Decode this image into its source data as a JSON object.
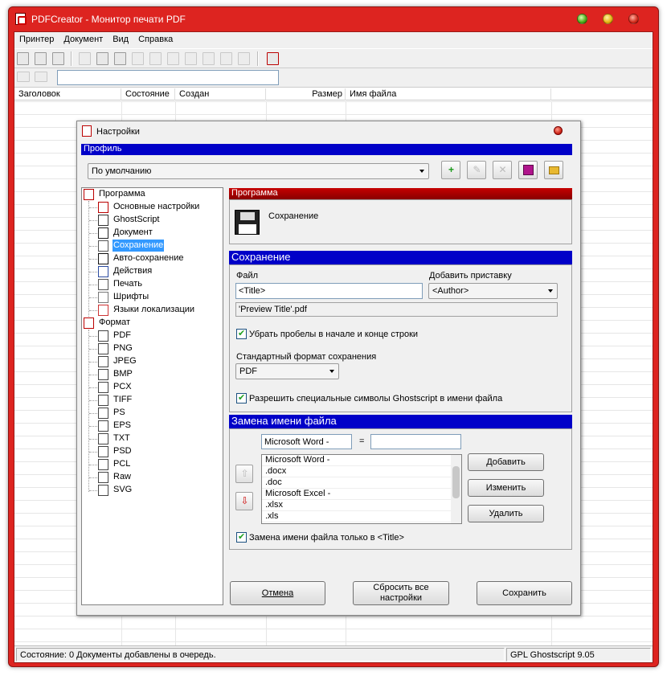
{
  "app": {
    "title": "PDFCreator - Монитор печати PDF"
  },
  "menu": [
    "Принтер",
    "Документ",
    "Вид",
    "Справка"
  ],
  "columns": [
    "Заголовок",
    "Состояние",
    "Создан",
    "Размер",
    "Имя файла"
  ],
  "status": {
    "left": "Состояние: 0 Документы добавлены в очередь.",
    "right": "GPL Ghostscript 9.05"
  },
  "dialog": {
    "title": "Настройки",
    "profile_header": "Профиль",
    "profile_value": "По умолчанию",
    "tree": {
      "program": "Программа",
      "program_items": [
        "Основные настройки",
        "GhostScript",
        "Документ",
        "Сохранение",
        "Авто-сохранение",
        "Действия",
        "Печать",
        "Шрифты",
        "Языки локализации"
      ],
      "format": "Формат",
      "format_items": [
        "PDF",
        "PNG",
        "JPEG",
        "BMP",
        "PCX",
        "TIFF",
        "PS",
        "EPS",
        "TXT",
        "PSD",
        "PCL",
        "Raw",
        "SVG"
      ],
      "selected": "Сохранение"
    },
    "section_header": "Программа",
    "section_title": "Сохранение",
    "save": {
      "header": "Сохранение",
      "file_label": "Файл",
      "file_value": "<Title>",
      "prefix_label": "Добавить приставку",
      "prefix_value": "<Author>",
      "preview": "'Preview Title'.pdf",
      "trim_label": "Убрать пробелы в начале и конце строки",
      "format_label": "Стандартный формат сохранения",
      "format_value": "PDF",
      "special_label": "Разрешить специальные символы  Ghostscript в имени файла"
    },
    "replace": {
      "header": "Замена имени файла",
      "find_value": "Microsoft Word -",
      "eq": "=",
      "replace_value": "",
      "items": [
        "Microsoft Word -",
        ".docx",
        ".doc",
        "Microsoft Excel -",
        ".xlsx",
        ".xls"
      ],
      "add": "Добавить",
      "edit": "Изменить",
      "delete": "Удалить",
      "title_only_label": "Замена имени файла только в <Title>"
    },
    "buttons": {
      "cancel": "Отмена",
      "reset_line1": "Сбросить все",
      "reset_line2": "настройки",
      "save": "Сохранить"
    }
  }
}
